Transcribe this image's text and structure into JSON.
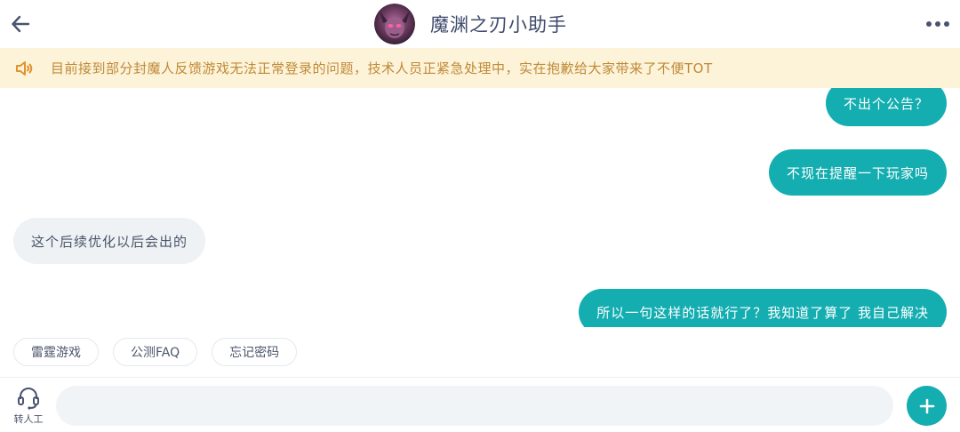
{
  "header": {
    "title": "魔渊之刃小助手",
    "back_icon": "arrow-left-icon",
    "more_icon": "more-dots-icon"
  },
  "notice": {
    "icon": "speaker-icon",
    "text": "目前接到部分封魔人反馈游戏无法正常登录的问题，技术人员正紧急处理中，实在抱歉给大家带来了不便TOT"
  },
  "messages": [
    {
      "side": "out",
      "text": "不出个公告？"
    },
    {
      "side": "out",
      "text": "不现在提醒一下玩家吗"
    },
    {
      "side": "in",
      "text": "这个后续优化以后会出的"
    },
    {
      "side": "out",
      "text": "所以一句这样的话就行了？我知道了算了 我自己解决"
    }
  ],
  "quick_replies": [
    "雷霆游戏",
    "公测FAQ",
    "忘记密码"
  ],
  "bottom": {
    "agent_label": "转人工",
    "agent_icon": "headset-icon",
    "input_value": "",
    "add_icon": "plus-icon"
  },
  "colors": {
    "accent": "#14adb0",
    "notice_bg": "#fcf3d9",
    "notice_text": "#c08936",
    "incoming_bubble": "#eef2f5"
  }
}
